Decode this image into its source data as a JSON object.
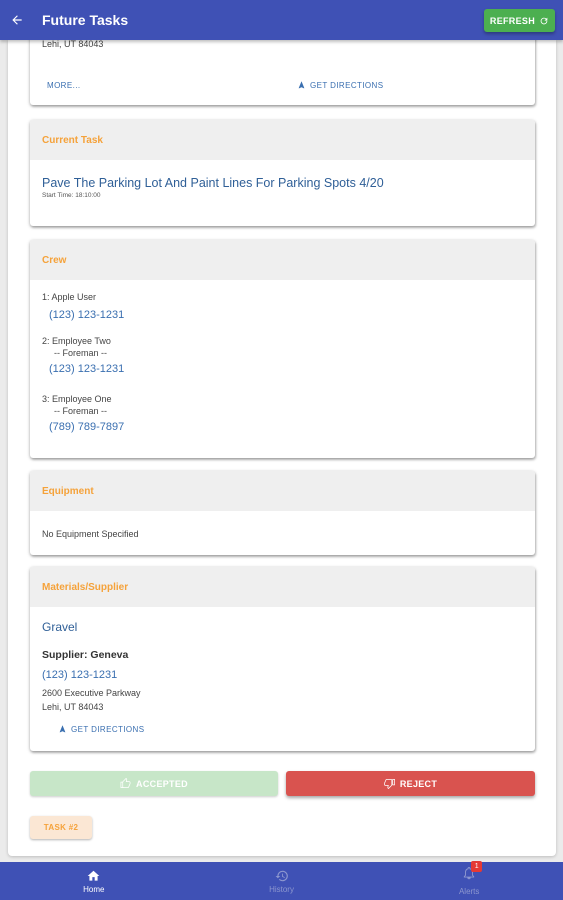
{
  "app_bar": {
    "title": "Future Tasks",
    "refresh_label": "REFRESH"
  },
  "top_card": {
    "address_partial": "Lehi, UT 84043",
    "more_label": "MORE...",
    "directions_label": "GET DIRECTIONS"
  },
  "current_task": {
    "header": "Current Task",
    "title": "Pave The Parking Lot And Paint Lines For Parking Spots 4/20",
    "start_time": "Start Time: 18:10:00"
  },
  "crew": {
    "header": "Crew",
    "members": [
      {
        "name": "1: Apple User",
        "role": "",
        "phone": "(123) 123-1231"
      },
      {
        "name": "2: Employee Two",
        "role": "-- Foreman --",
        "phone": "(123) 123-1231"
      },
      {
        "name": "3: Employee One",
        "role": "-- Foreman --",
        "phone": "(789) 789-7897"
      }
    ]
  },
  "equipment": {
    "header": "Equipment",
    "text": "No Equipment Specified"
  },
  "materials": {
    "header": "Materials/Supplier",
    "material": "Gravel",
    "supplier": "Supplier: Geneva",
    "phone": "(123) 123-1231",
    "address_line1": "2600 Executive Parkway",
    "address_line2": "Lehi, UT 84043",
    "directions_label": "GET DIRECTIONS"
  },
  "actions": {
    "accepted_label": "ACCEPTED",
    "reject_label": "REJECT",
    "task_label": "TASK #2"
  },
  "bottom_nav": {
    "home": "Home",
    "history": "History",
    "alerts": "Alerts",
    "alerts_badge": "1"
  },
  "colors": {
    "primary": "#3f51b5",
    "accent_orange": "#f5a23a",
    "link_blue": "#3a6fb0",
    "green": "#4caf50",
    "red": "#d9534f"
  }
}
